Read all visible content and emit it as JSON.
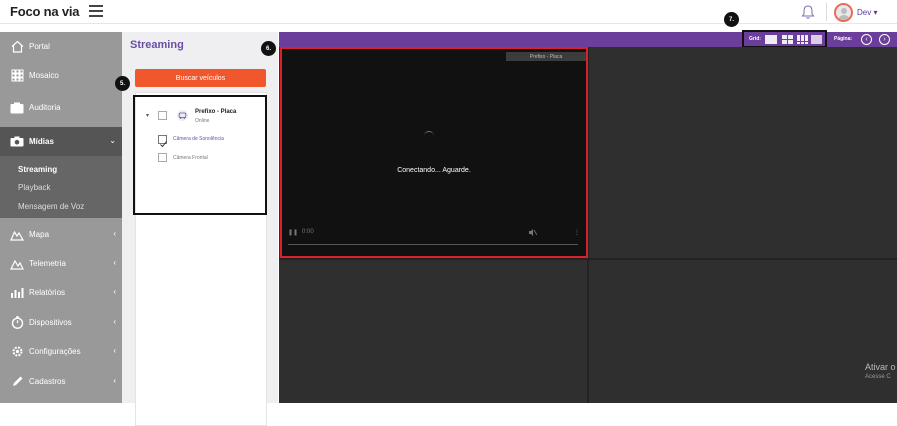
{
  "header": {
    "logo_text": "Foco na via",
    "user_name": "Dev",
    "user_caret": "▾"
  },
  "sidebar": {
    "items": [
      {
        "label": "Portal",
        "icon": "home-icon"
      },
      {
        "label": "Mosaico",
        "icon": "grid-icon"
      },
      {
        "label": "Auditoria",
        "icon": "folder-icon"
      },
      {
        "label": "Mídias",
        "icon": "camera-icon"
      },
      {
        "label": "Mapa",
        "icon": "map-icon"
      },
      {
        "label": "Telemetria",
        "icon": "telemetry-icon"
      },
      {
        "label": "Relatórios",
        "icon": "chart-icon"
      },
      {
        "label": "Dispositivos",
        "icon": "stopwatch-icon"
      },
      {
        "label": "Configurações",
        "icon": "gear-icon"
      },
      {
        "label": "Cadastros",
        "icon": "pencil-icon"
      }
    ],
    "sub_items": [
      {
        "label": "Streaming",
        "active": true
      },
      {
        "label": "Playback"
      },
      {
        "label": "Mensagem de Voz"
      }
    ]
  },
  "panel": {
    "title": "Streaming",
    "search_button": "Buscar veículos",
    "vehicle": {
      "title": "Prefixo - Placa",
      "status": "Online"
    },
    "cameras": [
      {
        "label": "Câmera de Sonolência",
        "checked": true
      },
      {
        "label": "Câmera Frontal",
        "checked": false
      }
    ]
  },
  "toolbar": {
    "grid_label": "Grid:",
    "page_label": "Página:",
    "prev": "‹",
    "next": "›"
  },
  "player": {
    "label": "Prefixo - Placa",
    "message": "Conectando... Aguarde.",
    "time": "0:00"
  },
  "badges": {
    "b5": "5.",
    "b6": "6.",
    "b7": "7."
  },
  "watermark": {
    "line1": "Ativar o",
    "line2": "Acesse C"
  },
  "colors": {
    "accent": "#6a3e9a",
    "button": "#f0572d",
    "highlight": "#d8212c"
  }
}
